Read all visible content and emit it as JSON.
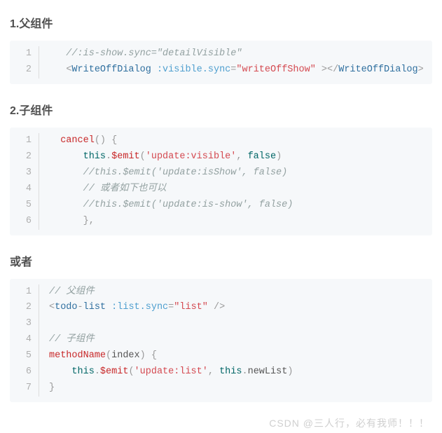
{
  "section1": {
    "title": "1.父组件",
    "lines": [
      {
        "n": "1",
        "seg": [
          {
            "t": "   //:is-show.sync=\"detailVisible\"",
            "c": "c-comment"
          }
        ]
      },
      {
        "n": "2",
        "seg": [
          {
            "t": "   "
          },
          {
            "t": "<",
            "c": "c-punct"
          },
          {
            "t": "WriteOffDialog",
            "c": "c-tagname"
          },
          {
            "t": " "
          },
          {
            "t": ":visible.sync",
            "c": "c-attr"
          },
          {
            "t": "=",
            "c": "c-punct"
          },
          {
            "t": "\"writeOffShow\"",
            "c": "c-string"
          },
          {
            "t": " >",
            "c": "c-punct"
          },
          {
            "t": "</",
            "c": "c-punct"
          },
          {
            "t": "WriteOffDialog",
            "c": "c-tagname"
          },
          {
            "t": ">",
            "c": "c-punct"
          }
        ]
      }
    ]
  },
  "section2": {
    "title": "2.子组件",
    "lines": [
      {
        "n": "1",
        "seg": [
          {
            "t": "  "
          },
          {
            "t": "cancel",
            "c": "c-method"
          },
          {
            "t": "(",
            "c": "c-paren"
          },
          {
            "t": ")",
            "c": "c-paren"
          },
          {
            "t": " "
          },
          {
            "t": "{",
            "c": "c-brace"
          }
        ]
      },
      {
        "n": "2",
        "seg": [
          {
            "t": "      "
          },
          {
            "t": "this",
            "c": "c-this"
          },
          {
            "t": ".",
            "c": "c-dot"
          },
          {
            "t": "$emit",
            "c": "c-method"
          },
          {
            "t": "(",
            "c": "c-paren"
          },
          {
            "t": "'update:visible'",
            "c": "c-string"
          },
          {
            "t": ", ",
            "c": "c-punct"
          },
          {
            "t": "false",
            "c": "c-false"
          },
          {
            "t": ")",
            "c": "c-paren"
          }
        ]
      },
      {
        "n": "3",
        "seg": [
          {
            "t": "      "
          },
          {
            "t": "//this.$emit('update:isShow', false)",
            "c": "c-comment"
          }
        ]
      },
      {
        "n": "4",
        "seg": [
          {
            "t": "      "
          },
          {
            "t": "// 或者如下也可以",
            "c": "c-comment"
          }
        ]
      },
      {
        "n": "5",
        "seg": [
          {
            "t": "      "
          },
          {
            "t": "//this.$emit('update:is-show', false)",
            "c": "c-comment"
          }
        ]
      },
      {
        "n": "6",
        "seg": [
          {
            "t": "      "
          },
          {
            "t": "}",
            "c": "c-brace"
          },
          {
            "t": ",",
            "c": "c-punct"
          }
        ]
      }
    ]
  },
  "section3": {
    "title": "或者",
    "lines": [
      {
        "n": "1",
        "seg": [
          {
            "t": "// 父组件",
            "c": "c-comment"
          }
        ]
      },
      {
        "n": "2",
        "seg": [
          {
            "t": "<",
            "c": "c-punct"
          },
          {
            "t": "todo",
            "c": "c-tagname"
          },
          {
            "t": "-",
            "c": "c-punct"
          },
          {
            "t": "list",
            "c": "c-tagname"
          },
          {
            "t": " "
          },
          {
            "t": ":list.sync",
            "c": "c-attr"
          },
          {
            "t": "=",
            "c": "c-punct"
          },
          {
            "t": "\"list\"",
            "c": "c-string"
          },
          {
            "t": " />",
            "c": "c-punct"
          }
        ]
      },
      {
        "n": "3",
        "seg": [
          {
            "t": " "
          }
        ]
      },
      {
        "n": "4",
        "seg": [
          {
            "t": "// 子组件",
            "c": "c-comment"
          }
        ]
      },
      {
        "n": "5",
        "seg": [
          {
            "t": "methodName",
            "c": "c-method"
          },
          {
            "t": "(",
            "c": "c-paren"
          },
          {
            "t": "index",
            "c": "c-param"
          },
          {
            "t": ")",
            "c": "c-paren"
          },
          {
            "t": " "
          },
          {
            "t": "{",
            "c": "c-brace"
          }
        ]
      },
      {
        "n": "6",
        "seg": [
          {
            "t": "    "
          },
          {
            "t": "this",
            "c": "c-this"
          },
          {
            "t": ".",
            "c": "c-dot"
          },
          {
            "t": "$emit",
            "c": "c-method"
          },
          {
            "t": "(",
            "c": "c-paren"
          },
          {
            "t": "'update:list'",
            "c": "c-string"
          },
          {
            "t": ", ",
            "c": "c-punct"
          },
          {
            "t": "this",
            "c": "c-this"
          },
          {
            "t": ".",
            "c": "c-dot"
          },
          {
            "t": "newList",
            "c": "c-name"
          },
          {
            "t": ")",
            "c": "c-paren"
          }
        ]
      },
      {
        "n": "7",
        "seg": [
          {
            "t": "}",
            "c": "c-brace"
          }
        ]
      }
    ]
  },
  "watermark": "CSDN @三人行，必有我师！！！"
}
